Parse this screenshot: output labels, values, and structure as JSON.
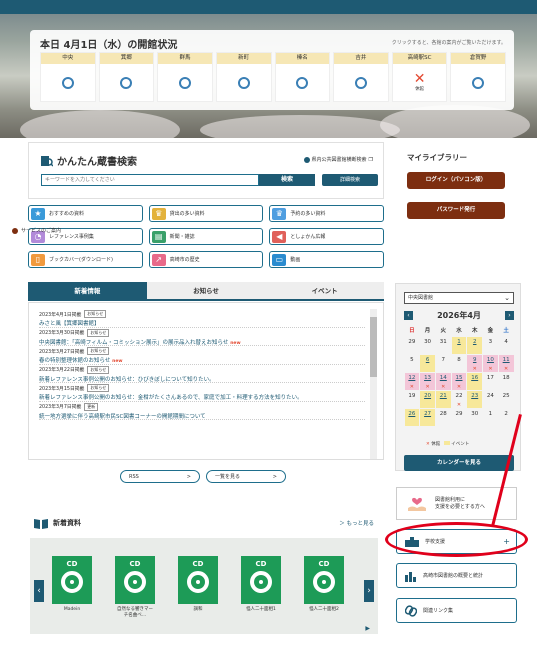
{
  "status": {
    "title": "本日 4月1日（水）の開館状況",
    "note": "クリックすると、各館の案内がご覧いただけます。",
    "branches": [
      {
        "name": "中央",
        "state": "open"
      },
      {
        "name": "箕郷",
        "state": "open"
      },
      {
        "name": "群馬",
        "state": "open"
      },
      {
        "name": "新町",
        "state": "open"
      },
      {
        "name": "榛名",
        "state": "open"
      },
      {
        "name": "吉井",
        "state": "open"
      },
      {
        "name": "高崎駅SC",
        "state": "closed",
        "label": "休館"
      },
      {
        "name": "倉賀野",
        "state": "open"
      }
    ]
  },
  "search": {
    "title": "かんたん蔵書検索",
    "help": "県内公共図書館横断検索",
    "placeholder": "キーワードを入力してください",
    "search_label": "検索",
    "detail_label": "詳細検索"
  },
  "quick_links": [
    {
      "label": "おすすめの資料",
      "color": "#3a9ad9",
      "glyph": "★"
    },
    {
      "label": "貸出の多い資料",
      "color": "#e3b23c",
      "glyph": "♛"
    },
    {
      "label": "予約の多い資料",
      "color": "#4f9ee0",
      "glyph": "♛"
    },
    {
      "label": "レファレンス事例集",
      "color": "#b28ad9",
      "glyph": "◔"
    },
    {
      "label": "新聞・雑誌",
      "color": "#3aa06a",
      "glyph": "▤"
    },
    {
      "label": "としょかん広報",
      "color": "#e0605a",
      "glyph": "◀"
    },
    {
      "label": "ブックカバー(ダウンロード)",
      "color": "#f09a3e",
      "glyph": "▯"
    },
    {
      "label": "高崎市の歴史",
      "color": "#e86a8a",
      "glyph": "↗"
    },
    {
      "label": "動画",
      "color": "#2a8bcf",
      "glyph": "▭"
    }
  ],
  "tabs": [
    "新着情報",
    "お知らせ",
    "イベント"
  ],
  "news": [
    {
      "date": "2023年4月1日掲載",
      "tag": "お知らせ",
      "title": "みさと風【箕郷図書館】",
      "is_new": false
    },
    {
      "date": "2023年3月30日掲載",
      "tag": "お知らせ",
      "title": "中央図書館：「高崎フィルム・コミッション展示」の展示品入れ替えお知らせ",
      "is_new": true
    },
    {
      "date": "2023年3月27日掲載",
      "tag": "お知らせ",
      "title": "春の特別整理休館のお知らせ",
      "is_new": true
    },
    {
      "date": "2023年3月22日掲載",
      "tag": "お知らせ",
      "title": "新着レファレンス事例公開のお知らせ：ひびきぼしについて知りたい。",
      "is_new": false
    },
    {
      "date": "2023年3月15日掲載",
      "tag": "お知らせ",
      "title": "新着レファレンス事例公開のお知らせ：金柑がたくさんあるので、家庭で加工・料理する方法を知りたい。",
      "is_new": false
    },
    {
      "date": "2023年3月7日掲載",
      "tag": "更新",
      "title": "統一地方選挙に伴う高崎駅市民SC図書コーナーの開館期間について",
      "is_new": false
    }
  ],
  "news_new_label": "new",
  "news_buttons": {
    "rss": "RSS",
    "list": "一覧を見る",
    "arrow": ">"
  },
  "newbooks": {
    "title": "新着資料",
    "more": "もっと見る",
    "items": [
      {
        "label": "CD",
        "title": "Madein"
      },
      {
        "label": "CD",
        "title": "自然なる響きマーチ名曲ベ…"
      },
      {
        "label": "CD",
        "title": "調和"
      },
      {
        "label": "CD",
        "title": "怪人二十面相1"
      },
      {
        "label": "CD",
        "title": "怪人二十面相2"
      }
    ]
  },
  "mylibrary": {
    "title": "マイライブラリー",
    "login": "ログイン（パソコン版）",
    "password": "パスワード発行",
    "service": "サービスのご案内"
  },
  "calendar": {
    "library": "中央図書館",
    "month": "2026年4月",
    "dow": [
      "日",
      "月",
      "火",
      "水",
      "木",
      "金",
      "土"
    ],
    "weeks": [
      [
        {
          "d": "29"
        },
        {
          "d": "30"
        },
        {
          "d": "31"
        },
        {
          "d": "1",
          "t": "ev",
          "u": true
        },
        {
          "d": "2",
          "t": "ev",
          "u": true
        },
        {
          "d": "3"
        },
        {
          "d": "4"
        }
      ],
      [
        {
          "d": "5"
        },
        {
          "d": "6",
          "t": "ev",
          "u": true
        },
        {
          "d": "7"
        },
        {
          "d": "8"
        },
        {
          "d": "9",
          "t": "closed",
          "u": true,
          "x": true
        },
        {
          "d": "10",
          "t": "closed",
          "u": true,
          "x": true
        },
        {
          "d": "11",
          "t": "closed",
          "u": true,
          "x": true
        }
      ],
      [
        {
          "d": "12",
          "t": "closed",
          "u": true,
          "x": true
        },
        {
          "d": "13",
          "t": "closed",
          "u": true,
          "x": true
        },
        {
          "d": "14",
          "t": "closed",
          "u": true,
          "x": true
        },
        {
          "d": "15",
          "t": "closed",
          "u": true,
          "x": true
        },
        {
          "d": "16",
          "t": "ev",
          "u": true
        },
        {
          "d": "17"
        },
        {
          "d": "18"
        }
      ],
      [
        {
          "d": "19"
        },
        {
          "d": "20",
          "t": "ev",
          "u": true
        },
        {
          "d": "21",
          "t": "ev",
          "u": true
        },
        {
          "d": "22",
          "x": true
        },
        {
          "d": "23",
          "t": "ev",
          "u": true
        },
        {
          "d": "24"
        },
        {
          "d": "25"
        }
      ],
      [
        {
          "d": "26",
          "t": "ev",
          "u": true
        },
        {
          "d": "27",
          "t": "ev",
          "u": true
        },
        {
          "d": "28"
        },
        {
          "d": "29"
        },
        {
          "d": "30"
        },
        {
          "d": "1"
        },
        {
          "d": "2"
        }
      ]
    ],
    "legend_closed": "休館",
    "legend_event": "イベント",
    "button": "カレンダーを見る"
  },
  "support": {
    "line1": "図書館利用に",
    "line2": "支援を必要とする方へ"
  },
  "side_links": [
    {
      "label": "学校支援",
      "plus": "+"
    },
    {
      "label": "高崎市図書館の概要と統計"
    },
    {
      "label": "関連リンク集"
    }
  ],
  "colors": {
    "accent": "#1e5a73",
    "brand_brown": "#7d2e10",
    "highlight": "#e0001b",
    "event": "#f7e89a",
    "closed": "#f3c6d8"
  }
}
